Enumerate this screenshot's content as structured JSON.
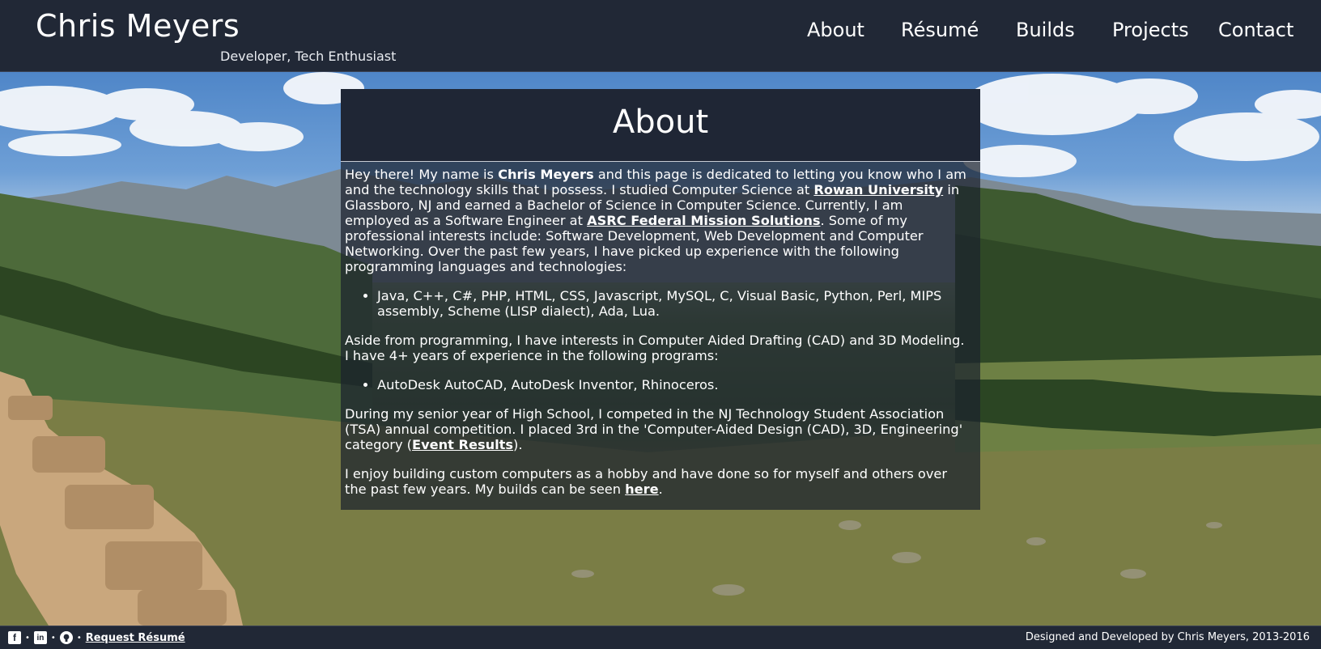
{
  "header": {
    "title": "Chris Meyers",
    "subtitle": "Developer, Tech Enthusiast",
    "nav": [
      {
        "label": "About"
      },
      {
        "label": "Résumé"
      },
      {
        "label": "Builds"
      },
      {
        "label": "Projects"
      },
      {
        "label": "Contact"
      }
    ]
  },
  "card": {
    "title": "About",
    "p1": {
      "t1": "Hey there! My name is ",
      "name": "Chris Meyers",
      "t2": " and this page is dedicated to letting you know who I am and the technology skills that I possess. I studied Computer Science at ",
      "link1": "Rowan University",
      "t3": " in Glassboro, NJ and earned a Bachelor of Science in Computer Science. Currently, I am employed as a Software Engineer at ",
      "link2": "ASRC Federal Mission Solutions",
      "t4": ". Some of my professional interests include: Software Development, Web Development and Computer Networking. Over the past few years, I have picked up experience with the following programming languages and technologies:"
    },
    "list1": [
      "Java, C++, C#, PHP, HTML, CSS, Javascript, MySQL, C, Visual Basic, Python, Perl, MIPS assembly, Scheme (LISP dialect), Ada, Lua."
    ],
    "p2": "Aside from programming, I have interests in Computer Aided Drafting (CAD) and 3D Modeling. I have 4+ years of experience in the following programs:",
    "list2": [
      "AutoDesk AutoCAD, AutoDesk Inventor, Rhinoceros."
    ],
    "p3": {
      "t1": "During my senior year of High School, I competed in the NJ Technology Student Association (TSA) annual competition. I placed 3rd in the 'Computer-Aided Design (CAD), 3D, Engineering' category (",
      "link": "Event Results",
      "t2": ")."
    },
    "p4": {
      "t1": "I enjoy building custom computers as a hobby and have done so for myself and others over the past few years. My builds can be seen ",
      "link": "here",
      "t2": "."
    }
  },
  "footer": {
    "icons": [
      "facebook-icon",
      "linkedin-icon",
      "github-icon"
    ],
    "separator": "•",
    "request_resume": "Request Résumé",
    "credit": "Designed and Developed by Chris Meyers, 2013-2016"
  },
  "colors": {
    "header_bg": "#212836",
    "card_bg": "#1b212e",
    "text": "#ffffff"
  }
}
